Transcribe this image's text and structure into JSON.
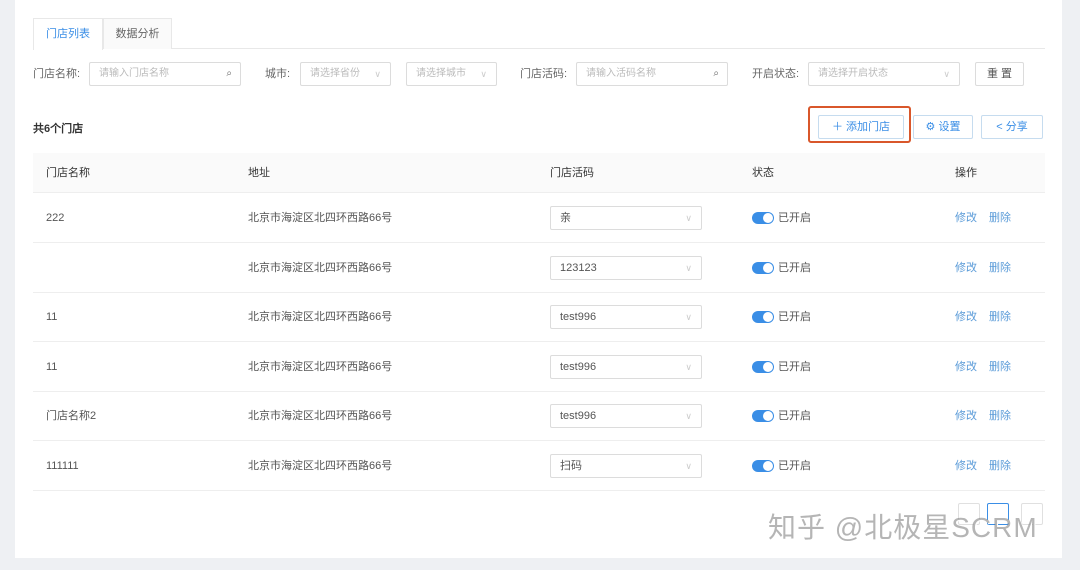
{
  "tabs": [
    "门店列表",
    "数据分析"
  ],
  "filters": {
    "name_label": "门店名称:",
    "name_placeholder": "请输入门店名称",
    "city_label": "城市:",
    "province_placeholder": "请选择省份",
    "city_placeholder": "请选择城市",
    "code_label": "门店活码:",
    "code_placeholder": "请输入活码名称",
    "status_label": "开启状态:",
    "status_placeholder": "请选择开启状态",
    "reset": "重 置"
  },
  "summary": "共6个门店",
  "toolbar": {
    "add": "添加门店",
    "settings": "设置",
    "share": "分享"
  },
  "columns": [
    "门店名称",
    "地址",
    "门店活码",
    "状态",
    "操作"
  ],
  "rows": [
    {
      "name": "222",
      "address": "北京市海淀区北四环西路66号",
      "code": "亲",
      "status": "已开启"
    },
    {
      "name": "",
      "address": "北京市海淀区北四环西路66号",
      "code": "123123",
      "status": "已开启"
    },
    {
      "name": "11",
      "address": "北京市海淀区北四环西路66号",
      "code": "test996",
      "status": "已开启"
    },
    {
      "name": "11",
      "address": "北京市海淀区北四环西路66号",
      "code": "test996",
      "status": "已开启"
    },
    {
      "name": "门店名称2",
      "address": "北京市海淀区北四环西路66号",
      "code": "test996",
      "status": "已开启"
    },
    {
      "name": "111111",
      "address": "北京市海淀区北四环西路66号",
      "code": "扫码",
      "status": "已开启"
    }
  ],
  "actions": {
    "edit": "修改",
    "delete": "删除"
  },
  "watermark": "知乎 @北极星SCRM",
  "colors": {
    "accent": "#3a8ee6",
    "highlight": "#d9572b"
  }
}
